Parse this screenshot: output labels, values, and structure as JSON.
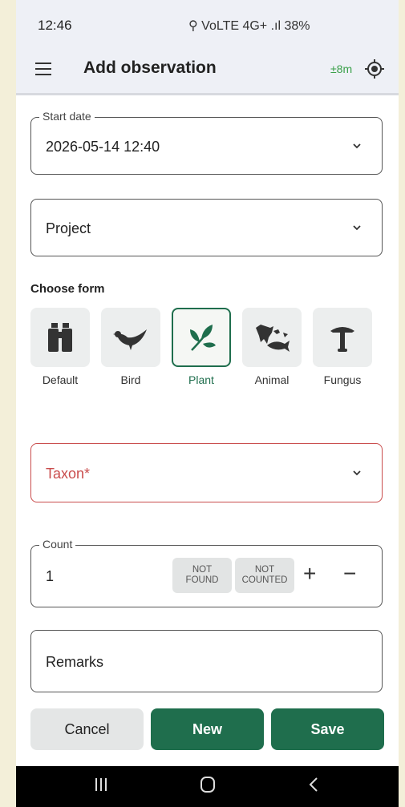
{
  "status": {
    "time": "12:46",
    "icons": "⚲ VoLTE 4G+ .ıl 38%",
    "battery": "38%"
  },
  "appbar": {
    "title": "Add observation",
    "accuracy": "±8m"
  },
  "start_date": {
    "label": "Start date",
    "value": "2026-05-14 12:40"
  },
  "project": {
    "placeholder": "Project"
  },
  "choose_form": {
    "label": "Choose form",
    "options": [
      {
        "label": "Default",
        "icon": "binoculars-icon",
        "selected": false
      },
      {
        "label": "Bird",
        "icon": "bird-icon",
        "selected": false
      },
      {
        "label": "Plant",
        "icon": "leaf-icon",
        "selected": true
      },
      {
        "label": "Animal",
        "icon": "animal-icon",
        "selected": false
      },
      {
        "label": "Fungus",
        "icon": "mushroom-icon",
        "selected": false
      }
    ]
  },
  "taxon": {
    "placeholder": "Taxon*"
  },
  "count": {
    "label": "Count",
    "value": "1",
    "not_found": "NOT FOUND",
    "not_counted": "NOT COUNTED",
    "plus": "+",
    "minus": "−"
  },
  "remarks": {
    "placeholder": "Remarks"
  },
  "actions": {
    "cancel": "Cancel",
    "new": "New",
    "save": "Save"
  },
  "colors": {
    "primary": "#1f6e4d",
    "error": "#c94c4c",
    "accuracy": "#3aa04a"
  }
}
